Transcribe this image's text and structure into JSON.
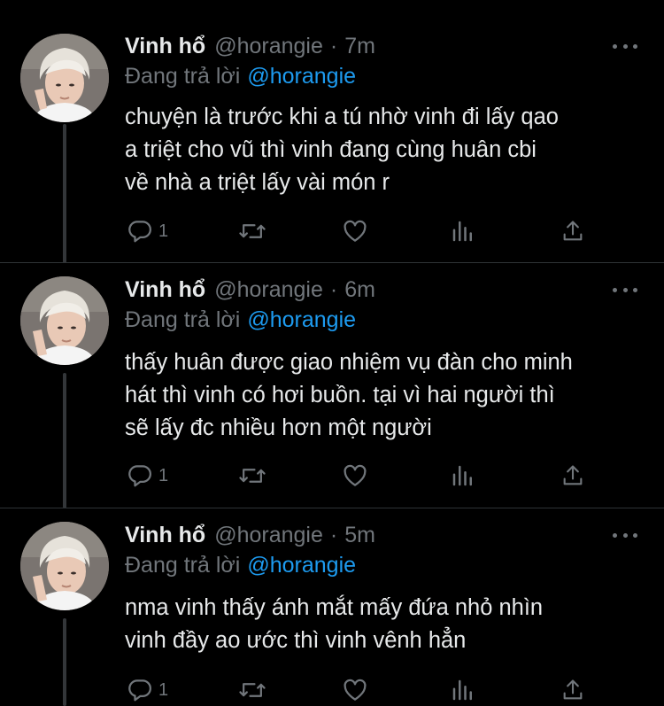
{
  "tweets": [
    {
      "display_name": "Vinh hổ",
      "handle": "@horangie",
      "separator": "·",
      "time": "7m",
      "replying_to_label": "Đang trả lời",
      "replying_to_handle": "@horangie",
      "text": "chuyện là trước khi a tú nhờ vinh đi lấy qao\na triệt cho vũ thì vinh đang cùng huân cbi\nvề nhà a triệt lấy vài món r",
      "reply_count": "1"
    },
    {
      "display_name": "Vinh hổ",
      "handle": "@horangie",
      "separator": "·",
      "time": "6m",
      "replying_to_label": "Đang trả lời",
      "replying_to_handle": "@horangie",
      "text": "thấy huân được giao nhiệm vụ đàn cho minh\nhát thì vinh có hơi buồn. tại vì hai người thì\nsẽ lấy đc nhiều hơn một người",
      "reply_count": "1"
    },
    {
      "display_name": "Vinh hổ",
      "handle": "@horangie",
      "separator": "·",
      "time": "5m",
      "replying_to_label": "Đang trả lời",
      "replying_to_handle": "@horangie",
      "text": "nma vinh thấy ánh mắt mấy đứa nhỏ nhìn\nvinh đầy ao ước thì vinh vênh hẳn",
      "reply_count": "1"
    }
  ],
  "icons": {
    "reply": "reply-icon",
    "retweet": "retweet-icon",
    "like": "heart-icon",
    "analytics": "analytics-icon",
    "share": "share-icon",
    "more": "more-icon"
  },
  "colors": {
    "background": "#000000",
    "text": "#e7e9ea",
    "secondary": "#71767b",
    "mention": "#1d9bf0",
    "thread_line": "#333639",
    "divider": "#2f3336"
  }
}
